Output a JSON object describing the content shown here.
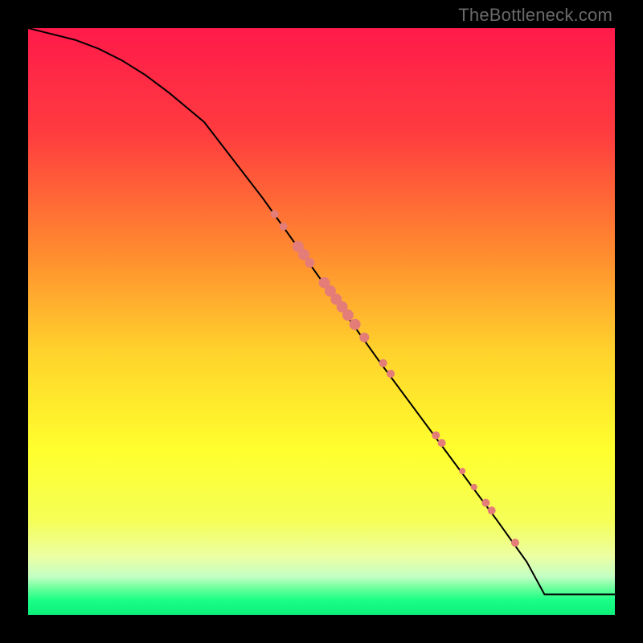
{
  "watermark": "TheBottleneck.com",
  "colors": {
    "marker": "#e47c78",
    "line": "#000000",
    "frame": "#000000"
  },
  "chart_data": {
    "type": "line",
    "title": "",
    "xlabel": "",
    "ylabel": "",
    "xlim": [
      0,
      100
    ],
    "ylim": [
      0,
      100
    ],
    "grid": false,
    "legend": false,
    "background_gradient_stops": [
      {
        "pos": 0.0,
        "color": "#ff1a4a"
      },
      {
        "pos": 0.18,
        "color": "#ff3c3f"
      },
      {
        "pos": 0.38,
        "color": "#ff8a2f"
      },
      {
        "pos": 0.55,
        "color": "#ffd22c"
      },
      {
        "pos": 0.72,
        "color": "#ffff2d"
      },
      {
        "pos": 0.84,
        "color": "#f5ff57"
      },
      {
        "pos": 0.9,
        "color": "#ecffa4"
      },
      {
        "pos": 0.935,
        "color": "#c3ffc3"
      },
      {
        "pos": 0.955,
        "color": "#6aff9c"
      },
      {
        "pos": 0.975,
        "color": "#1aff87"
      },
      {
        "pos": 1.0,
        "color": "#0cf07a"
      }
    ],
    "series": [
      {
        "name": "curve",
        "x": [
          0,
          4,
          8,
          12,
          16,
          20,
          24,
          30,
          40,
          50,
          60,
          70,
          80,
          85,
          88,
          100
        ],
        "y": [
          100,
          99,
          98,
          96.5,
          94.5,
          92,
          89,
          84,
          71,
          57,
          43,
          29.5,
          16,
          9,
          3.5,
          3.5
        ]
      }
    ],
    "markers": [
      {
        "x": 42.0,
        "y": 68.3,
        "r": 5
      },
      {
        "x": 43.5,
        "y": 66.2,
        "r": 5
      },
      {
        "x": 46.0,
        "y": 62.8,
        "r": 7
      },
      {
        "x": 47.0,
        "y": 61.4,
        "r": 7
      },
      {
        "x": 48.0,
        "y": 60.0,
        "r": 6
      },
      {
        "x": 50.5,
        "y": 56.6,
        "r": 7
      },
      {
        "x": 51.5,
        "y": 55.2,
        "r": 7
      },
      {
        "x": 52.5,
        "y": 53.8,
        "r": 7
      },
      {
        "x": 53.5,
        "y": 52.5,
        "r": 7
      },
      {
        "x": 54.5,
        "y": 51.1,
        "r": 7
      },
      {
        "x": 55.7,
        "y": 49.5,
        "r": 7
      },
      {
        "x": 57.3,
        "y": 47.3,
        "r": 6
      },
      {
        "x": 60.5,
        "y": 42.9,
        "r": 5
      },
      {
        "x": 61.8,
        "y": 41.1,
        "r": 5
      },
      {
        "x": 69.5,
        "y": 30.6,
        "r": 5
      },
      {
        "x": 70.5,
        "y": 29.3,
        "r": 5
      },
      {
        "x": 74.0,
        "y": 24.5,
        "r": 4
      },
      {
        "x": 76.0,
        "y": 21.8,
        "r": 4
      },
      {
        "x": 78.0,
        "y": 19.1,
        "r": 5
      },
      {
        "x": 79.0,
        "y": 17.8,
        "r": 5
      },
      {
        "x": 83.0,
        "y": 12.3,
        "r": 5
      }
    ]
  }
}
